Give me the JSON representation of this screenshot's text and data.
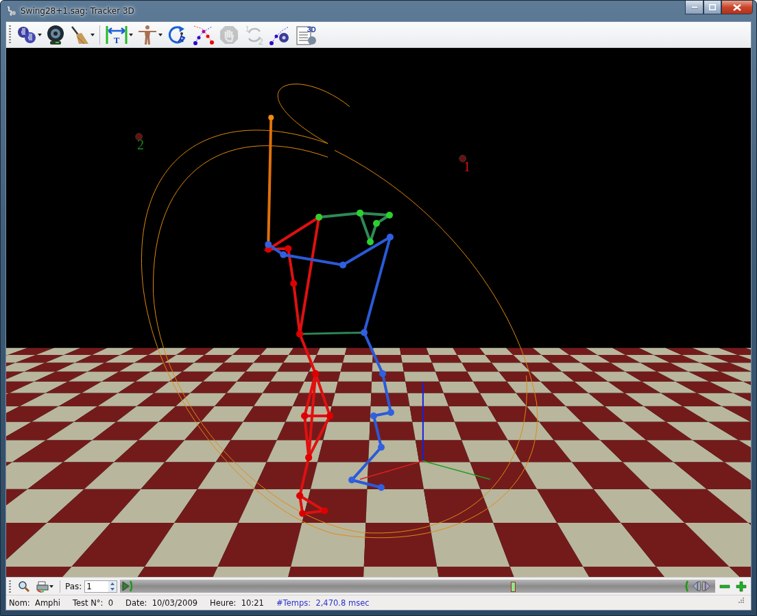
{
  "window": {
    "title": "Swing28+1.sag: Tracker 3D"
  },
  "toolbar": {
    "buttons": [
      {
        "kind": "gears",
        "disabled": false,
        "dropdown": true
      },
      {
        "kind": "camera",
        "disabled": false,
        "dropdown": false
      },
      {
        "kind": "broom",
        "disabled": false,
        "dropdown": true
      },
      {
        "kind": "measure",
        "glyph": "T",
        "disabled": false,
        "dropdown": true
      },
      {
        "kind": "body",
        "disabled": false,
        "dropdown": true
      },
      {
        "kind": "rotate",
        "disabled": false,
        "dropdown": false
      },
      {
        "kind": "cross",
        "disabled": false,
        "dropdown": false
      },
      {
        "kind": "stop",
        "disabled": true,
        "dropdown": false
      },
      {
        "kind": "cycle",
        "glyphs": [
          "1",
          "2"
        ],
        "disabled": true,
        "dropdown": false
      },
      {
        "kind": "track-gears",
        "disabled": false,
        "dropdown": false
      },
      {
        "kind": "doc",
        "glyph": "3D",
        "disabled": false,
        "dropdown": false
      }
    ]
  },
  "scene": {
    "markers": [
      {
        "label": "2",
        "color": "#1a8a1a"
      },
      {
        "label": "1",
        "color": "#e01010"
      }
    ]
  },
  "playbar": {
    "step_label": "Pas:",
    "step_value": "1",
    "timeline": {
      "level": 0.66
    }
  },
  "status_bar": {
    "fields": [
      {
        "kind": "info",
        "label": "Nom:",
        "value": "Amphi"
      },
      {
        "kind": "info",
        "label": "Test N°:",
        "value": "0"
      },
      {
        "kind": "info",
        "label": "Date:",
        "value": "10/03/2009"
      },
      {
        "kind": "info",
        "label": "Heure:",
        "value": "10:21"
      },
      {
        "kind": "time",
        "label": "#Temps:",
        "value": "2,470.8 msec"
      }
    ]
  }
}
